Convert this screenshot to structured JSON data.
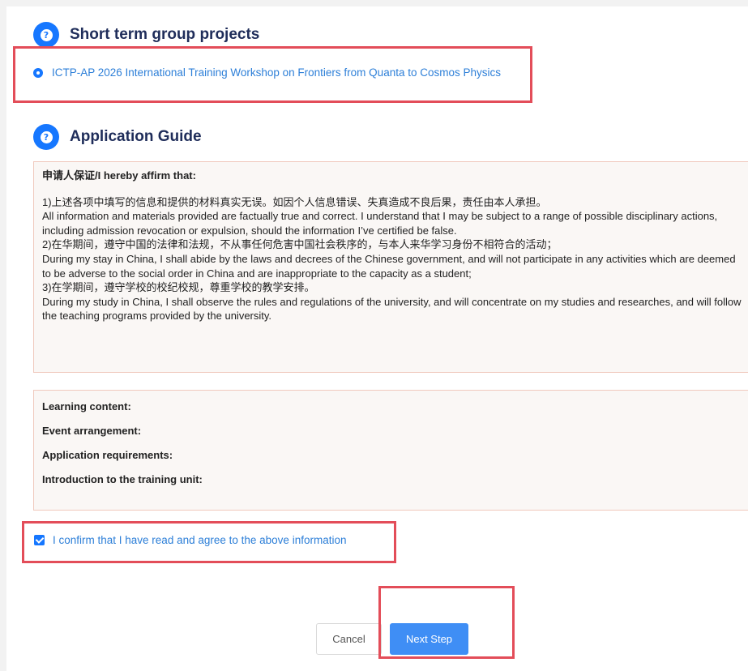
{
  "sections": {
    "short_term": {
      "title": "Short term group projects"
    },
    "guide": {
      "title": "Application Guide"
    }
  },
  "project": {
    "selected_label": "ICTP-AP 2026 International Training Workshop on Frontiers from Quanta to Cosmos Physics"
  },
  "affirmation": {
    "title": "申请人保证/I hereby affirm that:",
    "lines": [
      "1)上述各项中填写的信息和提供的材料真实无误。如因个人信息错误、失真造成不良后果，责任由本人承担。",
      "All information and materials provided are factually true and correct. I understand that I may be subject to a range of possible disciplinary actions, including admission revocation or expulsion, should the information I’ve certified be false.",
      "2)在华期间，遵守中国的法律和法规，不从事任何危害中国社会秩序的，与本人来华学习身份不相符合的活动；",
      "During my stay in China, I shall abide by the laws and decrees of the Chinese government, and will not participate in any activities which are deemed to be adverse to the social order in China and are inappropriate to the capacity as a student;",
      "3)在学期间，遵守学校的校纪校规，尊重学校的教学安排。",
      " During my study in China, I shall observe the rules and regulations of the university, and will concentrate on my studies and researches, and will follow the teaching programs provided by the university."
    ]
  },
  "info_fields": {
    "learning_content": "Learning content:",
    "event_arrangement": "Event arrangement:",
    "application_requirements": "Application requirements:",
    "training_unit": "Introduction to the training unit:"
  },
  "confirm": {
    "label": "I confirm that I have read and agree to the above information",
    "checked": true
  },
  "buttons": {
    "cancel": "Cancel",
    "next": "Next Step"
  },
  "colors": {
    "accent": "#1677ff",
    "link_text": "#2d7fd8",
    "highlight_border": "#e34d59",
    "panel_border": "#f0c9bd",
    "panel_bg": "#faf7f5"
  },
  "icons": {
    "section": "question-circle-icon",
    "radio": "radio-selected-icon",
    "checkbox": "checkbox-checked-icon"
  }
}
